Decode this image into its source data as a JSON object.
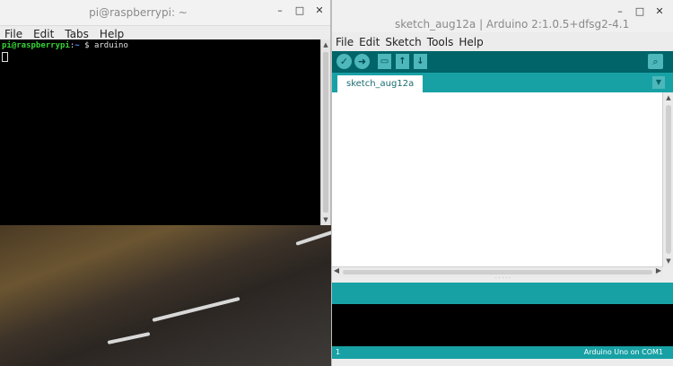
{
  "terminal": {
    "title": "pi@raspberrypi: ~",
    "menu": [
      "File",
      "Edit",
      "Tabs",
      "Help"
    ],
    "prompt_user": "pi@raspberrypi",
    "prompt_sep": ":",
    "prompt_path": "~",
    "prompt_symbol": " $ ",
    "command": "arduino"
  },
  "window_controls": {
    "minimize": "–",
    "maximize": "□",
    "close": "✕"
  },
  "arduino": {
    "title": "sketch_aug12a | Arduino 2:1.0.5+dfsg2-4.1",
    "menu": [
      "File",
      "Edit",
      "Sketch",
      "Tools",
      "Help"
    ],
    "toolbar": {
      "verify_icon": "✓",
      "upload_icon": "➜",
      "new_icon": "▭",
      "open_icon": "↑",
      "save_icon": "↓",
      "serial_monitor_icon": "⌕"
    },
    "tab_label": "sketch_aug12a",
    "tab_menu_icon": "▼",
    "status_line": "1",
    "board": "Arduino Uno on COM1",
    "colors": {
      "toolbar": "#006468",
      "tabbar": "#17a1a5",
      "console": "#000000"
    }
  }
}
